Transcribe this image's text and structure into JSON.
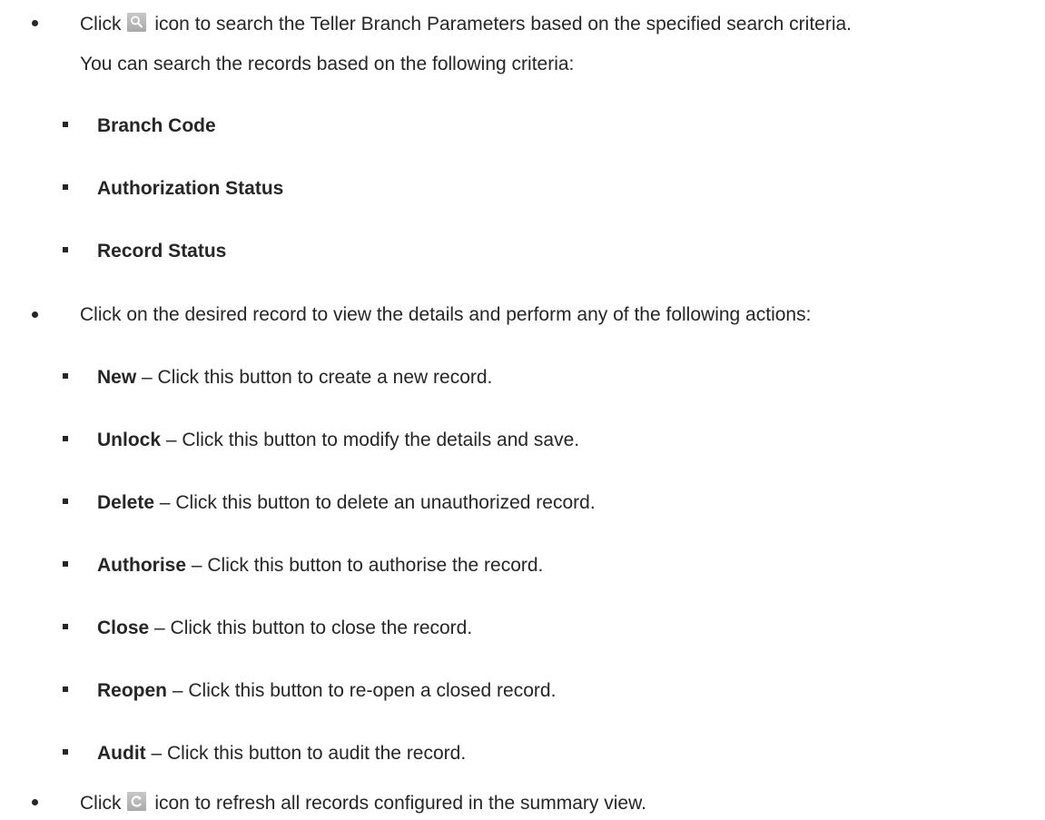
{
  "search_item": {
    "pre": "Click",
    "icon": "search-icon",
    "post": "icon to search the Teller Branch Parameters based on the specified search criteria.",
    "continuation": "You can search the records based on the following criteria:",
    "criteria": [
      "Branch Code",
      "Authorization Status",
      "Record Status"
    ]
  },
  "actions_item": {
    "text": "Click on the desired record to view the details and perform any of the following actions:",
    "actions": [
      {
        "name": "New",
        "desc": " – Click this button to create a new record."
      },
      {
        "name": "Unlock",
        "desc": " – Click this button to modify the details and save."
      },
      {
        "name": "Delete",
        "desc": " – Click this button to delete an unauthorized record."
      },
      {
        "name": "Authorise",
        "desc": " – Click this button to authorise the record."
      },
      {
        "name": "Close",
        "desc": " – Click this button to close the record."
      },
      {
        "name": "Reopen",
        "desc": " – Click this button to re-open a closed record."
      },
      {
        "name": "Audit",
        "desc": " – Click this button to audit the record."
      }
    ]
  },
  "refresh_item": {
    "pre": "Click",
    "icon": "refresh-icon",
    "post": "icon to refresh all records configured in the summary view."
  }
}
